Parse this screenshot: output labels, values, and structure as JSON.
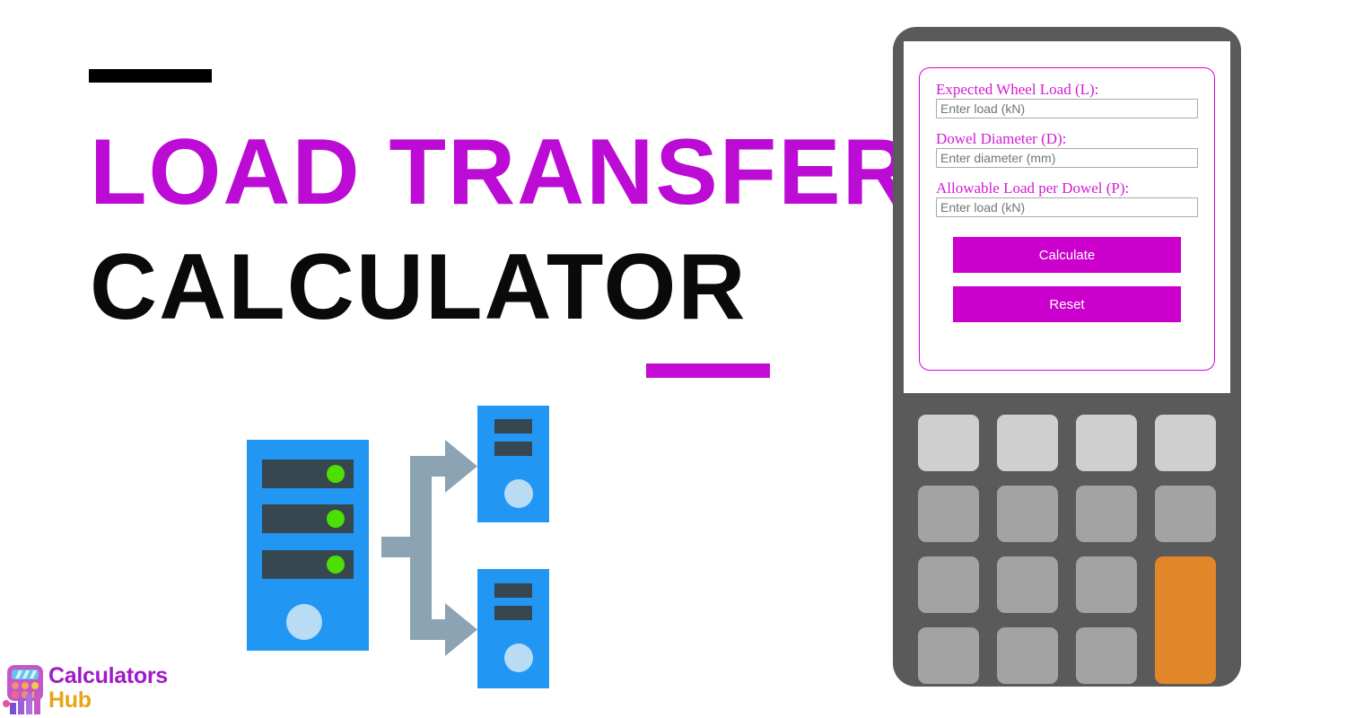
{
  "hero": {
    "title_line_1": "LOAD TRANSFER",
    "title_line_2": "CALCULATOR",
    "accent_color": "#BB0BD4",
    "title_color_2": "#0A0A0A",
    "rule_top_color": "#000000",
    "rule_bottom_color": "#C40BD4"
  },
  "logo": {
    "word_1": "Calculators",
    "word_2": "Hub",
    "word_1_color": "#A01BC8",
    "word_2_color": "#E8A317"
  },
  "illustration": {
    "name": "load-transfer-server-diagram",
    "server_color": "#2196F3",
    "slot_color": "#37474F",
    "led_color": "#4CE000",
    "dial_color": "#B9DCF5",
    "arrow_color": "#8CA3B3",
    "source_leds": 3,
    "target_nodes": 2
  },
  "calculator": {
    "body_color": "#5A5A5A",
    "screen_color": "#FFFFFF",
    "card_border_color": "#D400E0",
    "form": {
      "fields": [
        {
          "label": "Expected Wheel Load (L):",
          "placeholder": "Enter load (kN)",
          "value": ""
        },
        {
          "label": "Dowel Diameter (D):",
          "placeholder": "Enter diameter (mm)",
          "value": ""
        },
        {
          "label": "Allowable Load per Dowel (P):",
          "placeholder": "Enter load (kN)",
          "value": ""
        }
      ],
      "buttons": [
        {
          "label": "Calculate",
          "color": "#CC00CC"
        },
        {
          "label": "Reset",
          "color": "#CC00CC"
        }
      ]
    },
    "keypad": {
      "columns": 4,
      "rows": 4,
      "keys": [
        {
          "label": "",
          "style": "light"
        },
        {
          "label": "",
          "style": "light"
        },
        {
          "label": "",
          "style": "light"
        },
        {
          "label": "",
          "style": "light"
        },
        {
          "label": "",
          "style": "normal"
        },
        {
          "label": "",
          "style": "normal"
        },
        {
          "label": "",
          "style": "normal"
        },
        {
          "label": "",
          "style": "normal"
        },
        {
          "label": "",
          "style": "normal"
        },
        {
          "label": "",
          "style": "normal"
        },
        {
          "label": "",
          "style": "normal"
        },
        {
          "label": "",
          "style": "orange"
        },
        {
          "label": "",
          "style": "normal"
        },
        {
          "label": "",
          "style": "normal"
        },
        {
          "label": "",
          "style": "normal"
        }
      ]
    }
  }
}
